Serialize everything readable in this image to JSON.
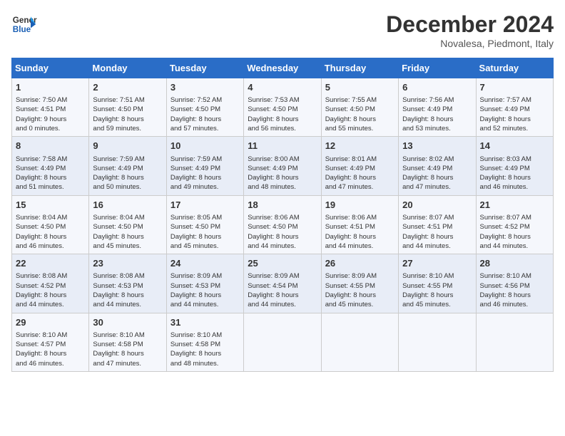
{
  "header": {
    "logo_general": "General",
    "logo_blue": "Blue",
    "month": "December 2024",
    "location": "Novalesa, Piedmont, Italy"
  },
  "days_of_week": [
    "Sunday",
    "Monday",
    "Tuesday",
    "Wednesday",
    "Thursday",
    "Friday",
    "Saturday"
  ],
  "weeks": [
    [
      {
        "day": "1",
        "info": "Sunrise: 7:50 AM\nSunset: 4:51 PM\nDaylight: 9 hours\nand 0 minutes."
      },
      {
        "day": "2",
        "info": "Sunrise: 7:51 AM\nSunset: 4:50 PM\nDaylight: 8 hours\nand 59 minutes."
      },
      {
        "day": "3",
        "info": "Sunrise: 7:52 AM\nSunset: 4:50 PM\nDaylight: 8 hours\nand 57 minutes."
      },
      {
        "day": "4",
        "info": "Sunrise: 7:53 AM\nSunset: 4:50 PM\nDaylight: 8 hours\nand 56 minutes."
      },
      {
        "day": "5",
        "info": "Sunrise: 7:55 AM\nSunset: 4:50 PM\nDaylight: 8 hours\nand 55 minutes."
      },
      {
        "day": "6",
        "info": "Sunrise: 7:56 AM\nSunset: 4:49 PM\nDaylight: 8 hours\nand 53 minutes."
      },
      {
        "day": "7",
        "info": "Sunrise: 7:57 AM\nSunset: 4:49 PM\nDaylight: 8 hours\nand 52 minutes."
      }
    ],
    [
      {
        "day": "8",
        "info": "Sunrise: 7:58 AM\nSunset: 4:49 PM\nDaylight: 8 hours\nand 51 minutes."
      },
      {
        "day": "9",
        "info": "Sunrise: 7:59 AM\nSunset: 4:49 PM\nDaylight: 8 hours\nand 50 minutes."
      },
      {
        "day": "10",
        "info": "Sunrise: 7:59 AM\nSunset: 4:49 PM\nDaylight: 8 hours\nand 49 minutes."
      },
      {
        "day": "11",
        "info": "Sunrise: 8:00 AM\nSunset: 4:49 PM\nDaylight: 8 hours\nand 48 minutes."
      },
      {
        "day": "12",
        "info": "Sunrise: 8:01 AM\nSunset: 4:49 PM\nDaylight: 8 hours\nand 47 minutes."
      },
      {
        "day": "13",
        "info": "Sunrise: 8:02 AM\nSunset: 4:49 PM\nDaylight: 8 hours\nand 47 minutes."
      },
      {
        "day": "14",
        "info": "Sunrise: 8:03 AM\nSunset: 4:49 PM\nDaylight: 8 hours\nand 46 minutes."
      }
    ],
    [
      {
        "day": "15",
        "info": "Sunrise: 8:04 AM\nSunset: 4:50 PM\nDaylight: 8 hours\nand 46 minutes."
      },
      {
        "day": "16",
        "info": "Sunrise: 8:04 AM\nSunset: 4:50 PM\nDaylight: 8 hours\nand 45 minutes."
      },
      {
        "day": "17",
        "info": "Sunrise: 8:05 AM\nSunset: 4:50 PM\nDaylight: 8 hours\nand 45 minutes."
      },
      {
        "day": "18",
        "info": "Sunrise: 8:06 AM\nSunset: 4:50 PM\nDaylight: 8 hours\nand 44 minutes."
      },
      {
        "day": "19",
        "info": "Sunrise: 8:06 AM\nSunset: 4:51 PM\nDaylight: 8 hours\nand 44 minutes."
      },
      {
        "day": "20",
        "info": "Sunrise: 8:07 AM\nSunset: 4:51 PM\nDaylight: 8 hours\nand 44 minutes."
      },
      {
        "day": "21",
        "info": "Sunrise: 8:07 AM\nSunset: 4:52 PM\nDaylight: 8 hours\nand 44 minutes."
      }
    ],
    [
      {
        "day": "22",
        "info": "Sunrise: 8:08 AM\nSunset: 4:52 PM\nDaylight: 8 hours\nand 44 minutes."
      },
      {
        "day": "23",
        "info": "Sunrise: 8:08 AM\nSunset: 4:53 PM\nDaylight: 8 hours\nand 44 minutes."
      },
      {
        "day": "24",
        "info": "Sunrise: 8:09 AM\nSunset: 4:53 PM\nDaylight: 8 hours\nand 44 minutes."
      },
      {
        "day": "25",
        "info": "Sunrise: 8:09 AM\nSunset: 4:54 PM\nDaylight: 8 hours\nand 44 minutes."
      },
      {
        "day": "26",
        "info": "Sunrise: 8:09 AM\nSunset: 4:55 PM\nDaylight: 8 hours\nand 45 minutes."
      },
      {
        "day": "27",
        "info": "Sunrise: 8:10 AM\nSunset: 4:55 PM\nDaylight: 8 hours\nand 45 minutes."
      },
      {
        "day": "28",
        "info": "Sunrise: 8:10 AM\nSunset: 4:56 PM\nDaylight: 8 hours\nand 46 minutes."
      }
    ],
    [
      {
        "day": "29",
        "info": "Sunrise: 8:10 AM\nSunset: 4:57 PM\nDaylight: 8 hours\nand 46 minutes."
      },
      {
        "day": "30",
        "info": "Sunrise: 8:10 AM\nSunset: 4:58 PM\nDaylight: 8 hours\nand 47 minutes."
      },
      {
        "day": "31",
        "info": "Sunrise: 8:10 AM\nSunset: 4:58 PM\nDaylight: 8 hours\nand 48 minutes."
      },
      {
        "day": "",
        "info": ""
      },
      {
        "day": "",
        "info": ""
      },
      {
        "day": "",
        "info": ""
      },
      {
        "day": "",
        "info": ""
      }
    ]
  ]
}
